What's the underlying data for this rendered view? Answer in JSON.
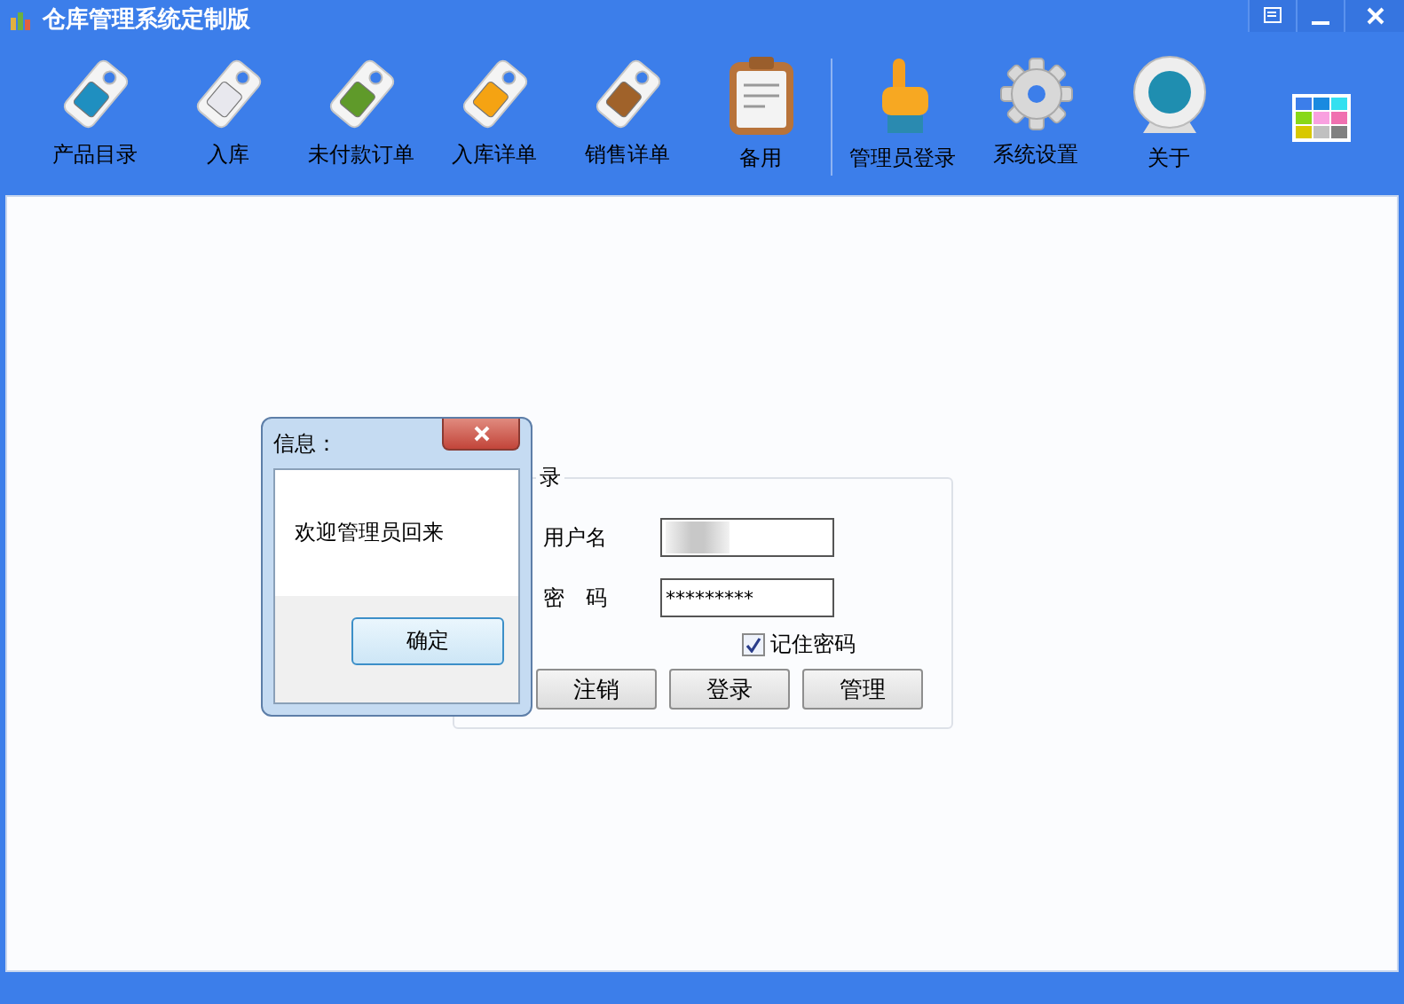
{
  "window": {
    "title": "仓库管理系统定制版"
  },
  "toolbar": {
    "groups": [
      [
        {
          "label": "产品目录",
          "kind": "tag",
          "color": "#1f8fc0"
        },
        {
          "label": "入库",
          "kind": "tag",
          "color": "#e8e8ee"
        },
        {
          "label": "未付款订单",
          "kind": "tag",
          "color": "#5f9a2a"
        },
        {
          "label": "入库详单",
          "kind": "tag",
          "color": "#f5a312"
        },
        {
          "label": "销售详单",
          "kind": "tag",
          "color": "#a0622a"
        },
        {
          "label": "备用",
          "kind": "clipboard"
        }
      ],
      [
        {
          "label": "管理员登录",
          "kind": "pointer"
        },
        {
          "label": "系统设置",
          "kind": "gear"
        },
        {
          "label": "关于",
          "kind": "webcam"
        }
      ]
    ]
  },
  "login": {
    "title": "录",
    "fields": [
      {
        "label": "用户名",
        "kind": "blurred"
      },
      {
        "label": "密　码",
        "kind": "password",
        "value": "*********"
      }
    ],
    "remember": {
      "label": "记住密码",
      "checked": true
    },
    "buttons": [
      "注销",
      "登录",
      "管理"
    ]
  },
  "dialog": {
    "title": "信息：",
    "message": "欢迎管理员回来",
    "button": "确定"
  }
}
